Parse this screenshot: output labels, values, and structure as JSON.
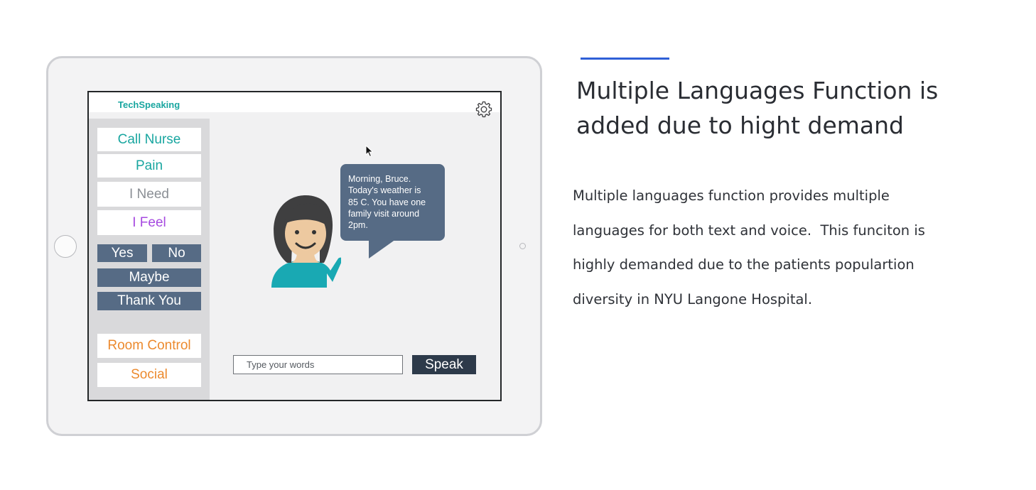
{
  "app": {
    "name": "TechSpeaking",
    "settings_icon": "gear-icon"
  },
  "sidebar": {
    "quick_buttons": [
      {
        "label": "Call Nurse",
        "color": "#19a6a0"
      },
      {
        "label": "Pain",
        "color": "#19a6a0"
      },
      {
        "label": "I Need",
        "color": "#8b8f95"
      },
      {
        "label": "I Feel",
        "color": "#a64ae0"
      }
    ],
    "responses": [
      {
        "label": "Yes"
      },
      {
        "label": "No"
      },
      {
        "label": "Maybe"
      },
      {
        "label": "Thank You"
      }
    ],
    "bottom_buttons": [
      {
        "label": "Room Control",
        "color": "#ec8a2e"
      },
      {
        "label": "Social",
        "color": "#ec8a2e"
      }
    ]
  },
  "chat": {
    "lines": [
      "Morning, Bruce.",
      "Today's weather is",
      "85 C. You have one",
      "family visit around",
      "2pm."
    ],
    "bubble_color": "#566b85"
  },
  "avatar": {
    "icon": "nurse-avatar-icon",
    "hair_color": "#3f3f40",
    "skin_color": "#edc9a0",
    "shirt_color": "#19a9b3"
  },
  "input": {
    "placeholder": "Type your words",
    "value": ""
  },
  "speak_label": "Speak",
  "article": {
    "accent_color": "#2f5fd7",
    "heading_lines": [
      "Multiple Languages Function is",
      "added due to hight demand"
    ],
    "body_lines": [
      "Multiple languages function provides multiple",
      "languages for both text and voice.  This funciton is",
      "highly demanded due to the patients populartion",
      "diversity in NYU Langone Hospital."
    ]
  }
}
